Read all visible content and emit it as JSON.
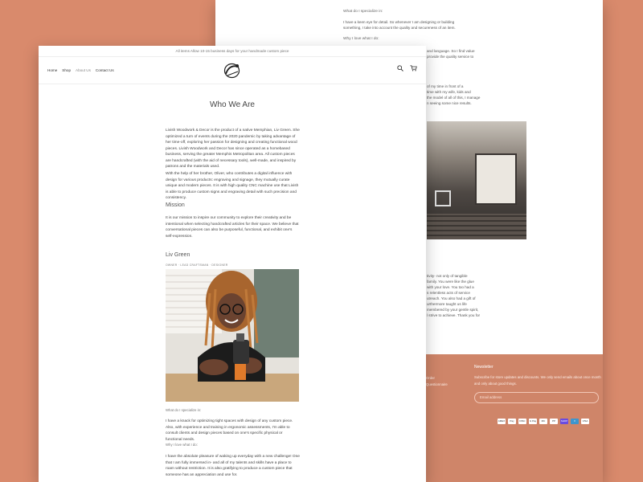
{
  "back": {
    "q_specialize": "What do I specialize in:",
    "p1": "I have a keen eye for detail. So whenever I am designing or building something, I take into account the quality and secureness of an item.",
    "q_love": "Why I love what I do:",
    "p2_tail": [
      "and language. So I find value",
      "provide the quality service to"
    ],
    "p3_tail": [
      "of my time in front of a",
      "time with my wife, kids and",
      "the model of all of this, I manage",
      "n seeing some nice results."
    ],
    "p4_tail": [
      "tivity- not only of tangible",
      "family. You were like the glue",
      "with your love. You too had a",
      "s relentless acts of service",
      "utreach. You also had a gift of",
      "urthermore taught us life",
      "membered by your gentle spirit,",
      "l strive to achieve. Thank you for"
    ],
    "footer": {
      "newsletter_title": "Newsletter",
      "newsletter_text": "Subscribe for store updates and discounts. We only send emails about once month and only about good things.",
      "links": [
        "Order",
        "Questionnaire"
      ],
      "email_placeholder": "Email address",
      "payments": [
        "AMEX",
        "Pay",
        "DISC",
        "G Pay",
        "MC",
        "PP",
        "SHOP",
        "V",
        "VISA"
      ]
    }
  },
  "front": {
    "announcement": "All items Allow 10-15 business days for your handmade custom piece",
    "nav": [
      "Home",
      "Shop",
      "About Us",
      "Contact Us"
    ],
    "title": "Who We Are",
    "intro": "Livish Woodwork & Decor is the product of a native Memphian, Liv Green. She optimized a turn of events during the 2020 pandemic by taking advantage of her time-off, exploring her passion for designing and creating functional wood pieces. Livish Woodwork and Decor has since operated as a homebased business, serving the greater Memphis Metropolitan area. All custom pieces are handcrafted (with the aid of necessary tools), well-made, and inspired by patrons and the materials used.",
    "help": "With the help of her brother, Oliver, who contributes a digital influence with design for various products: engraving and signage, they mutually curate unique and modern pieces. It is with high quality CNC machine use that Livish is able to produce custom signs and engraving detail with such precision and consistency.",
    "mission_heading": "Mission",
    "mission": "It is our mission to inspire our community to explore their creativity and be intentional when selecting handcrafted articles for their space. We believe that conversational pieces can also be purposeful, functional, and exhibit one's self-expression.",
    "person_name": "Liv Green",
    "person_role": "OWNER · LEAD CRAFTSMAN · DESIGNER",
    "q_specialize": "What do I specialize in:",
    "specialize": "I have a knack for optimizing tight spaces with design of any custom piece. Also, with experience and training in ergonomic assessments, I'm able to consult clients and design pieces based on one's specific physical or functional needs.",
    "q_love": "Why I love what I do:",
    "love": "I have the absolute pleasure of waking up everyday with a new challenge! One that I am fully immersed in- and all of my talents and skills have a place to roam without restriction. It is also gratifying to produce a custom piece that someone has an appreciation and use for."
  }
}
